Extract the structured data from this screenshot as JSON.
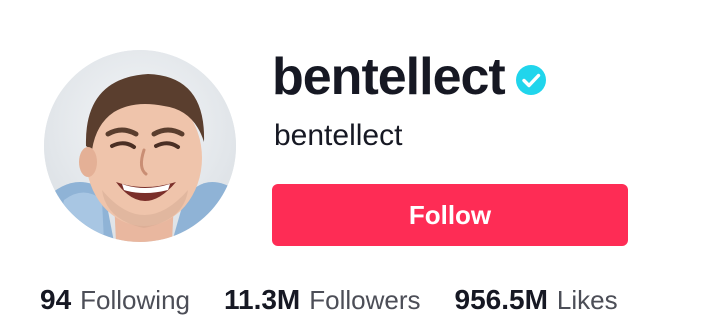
{
  "profile": {
    "username": "bentellect",
    "nickname": "bentellect",
    "verified": true,
    "avatar_icon": "profile-photo",
    "follow_label": "Follow"
  },
  "stats": {
    "following": {
      "count": "94",
      "label": "Following"
    },
    "followers": {
      "count": "11.3M",
      "label": "Followers"
    },
    "likes": {
      "count": "956.5M",
      "label": "Likes"
    }
  },
  "colors": {
    "follow_button": "#fe2c55",
    "verified_badge": "#20d5ec",
    "text_primary": "#161823",
    "text_secondary": "#4c4e57"
  }
}
